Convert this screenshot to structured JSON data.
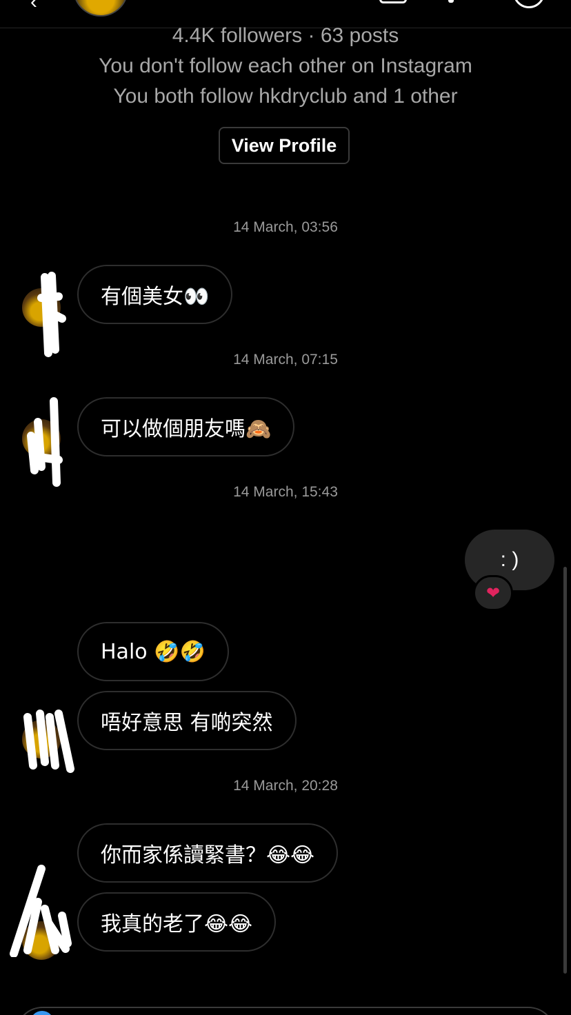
{
  "header": {
    "back_icon": "chevron-left-icon",
    "icons": [
      "phone-icon",
      "video-icon",
      "info-icon"
    ]
  },
  "profile": {
    "stats": "4.4K followers · 63 posts",
    "follow_status": "You don't follow each other on Instagram",
    "mutual": "You both follow hkdryclub and 1 other",
    "view_profile_label": "View Profile"
  },
  "conversation": {
    "groups": [
      {
        "timestamp": "14 March, 03:56",
        "messages": [
          "有個美女👀"
        ]
      },
      {
        "timestamp": "14 March, 07:15",
        "messages": [
          "可以做個朋友嗎🙈"
        ]
      },
      {
        "timestamp": "14 March, 15:43",
        "own_message": ": )",
        "reaction": "❤"
      },
      {
        "timestamp": "",
        "messages": [
          "Halo 🤣🤣",
          "唔好意思 有啲突然"
        ]
      },
      {
        "timestamp": "14 March, 20:28",
        "messages": [
          "你而家係讀緊書？😂😂",
          "我真的老了😂😂"
        ]
      }
    ]
  },
  "colors": {
    "background": "#000000",
    "bubble_border": "#2e2e2e",
    "own_bubble": "#262626",
    "secondary_text": "#a8a8a8",
    "reaction_heart": "#e0245e"
  }
}
